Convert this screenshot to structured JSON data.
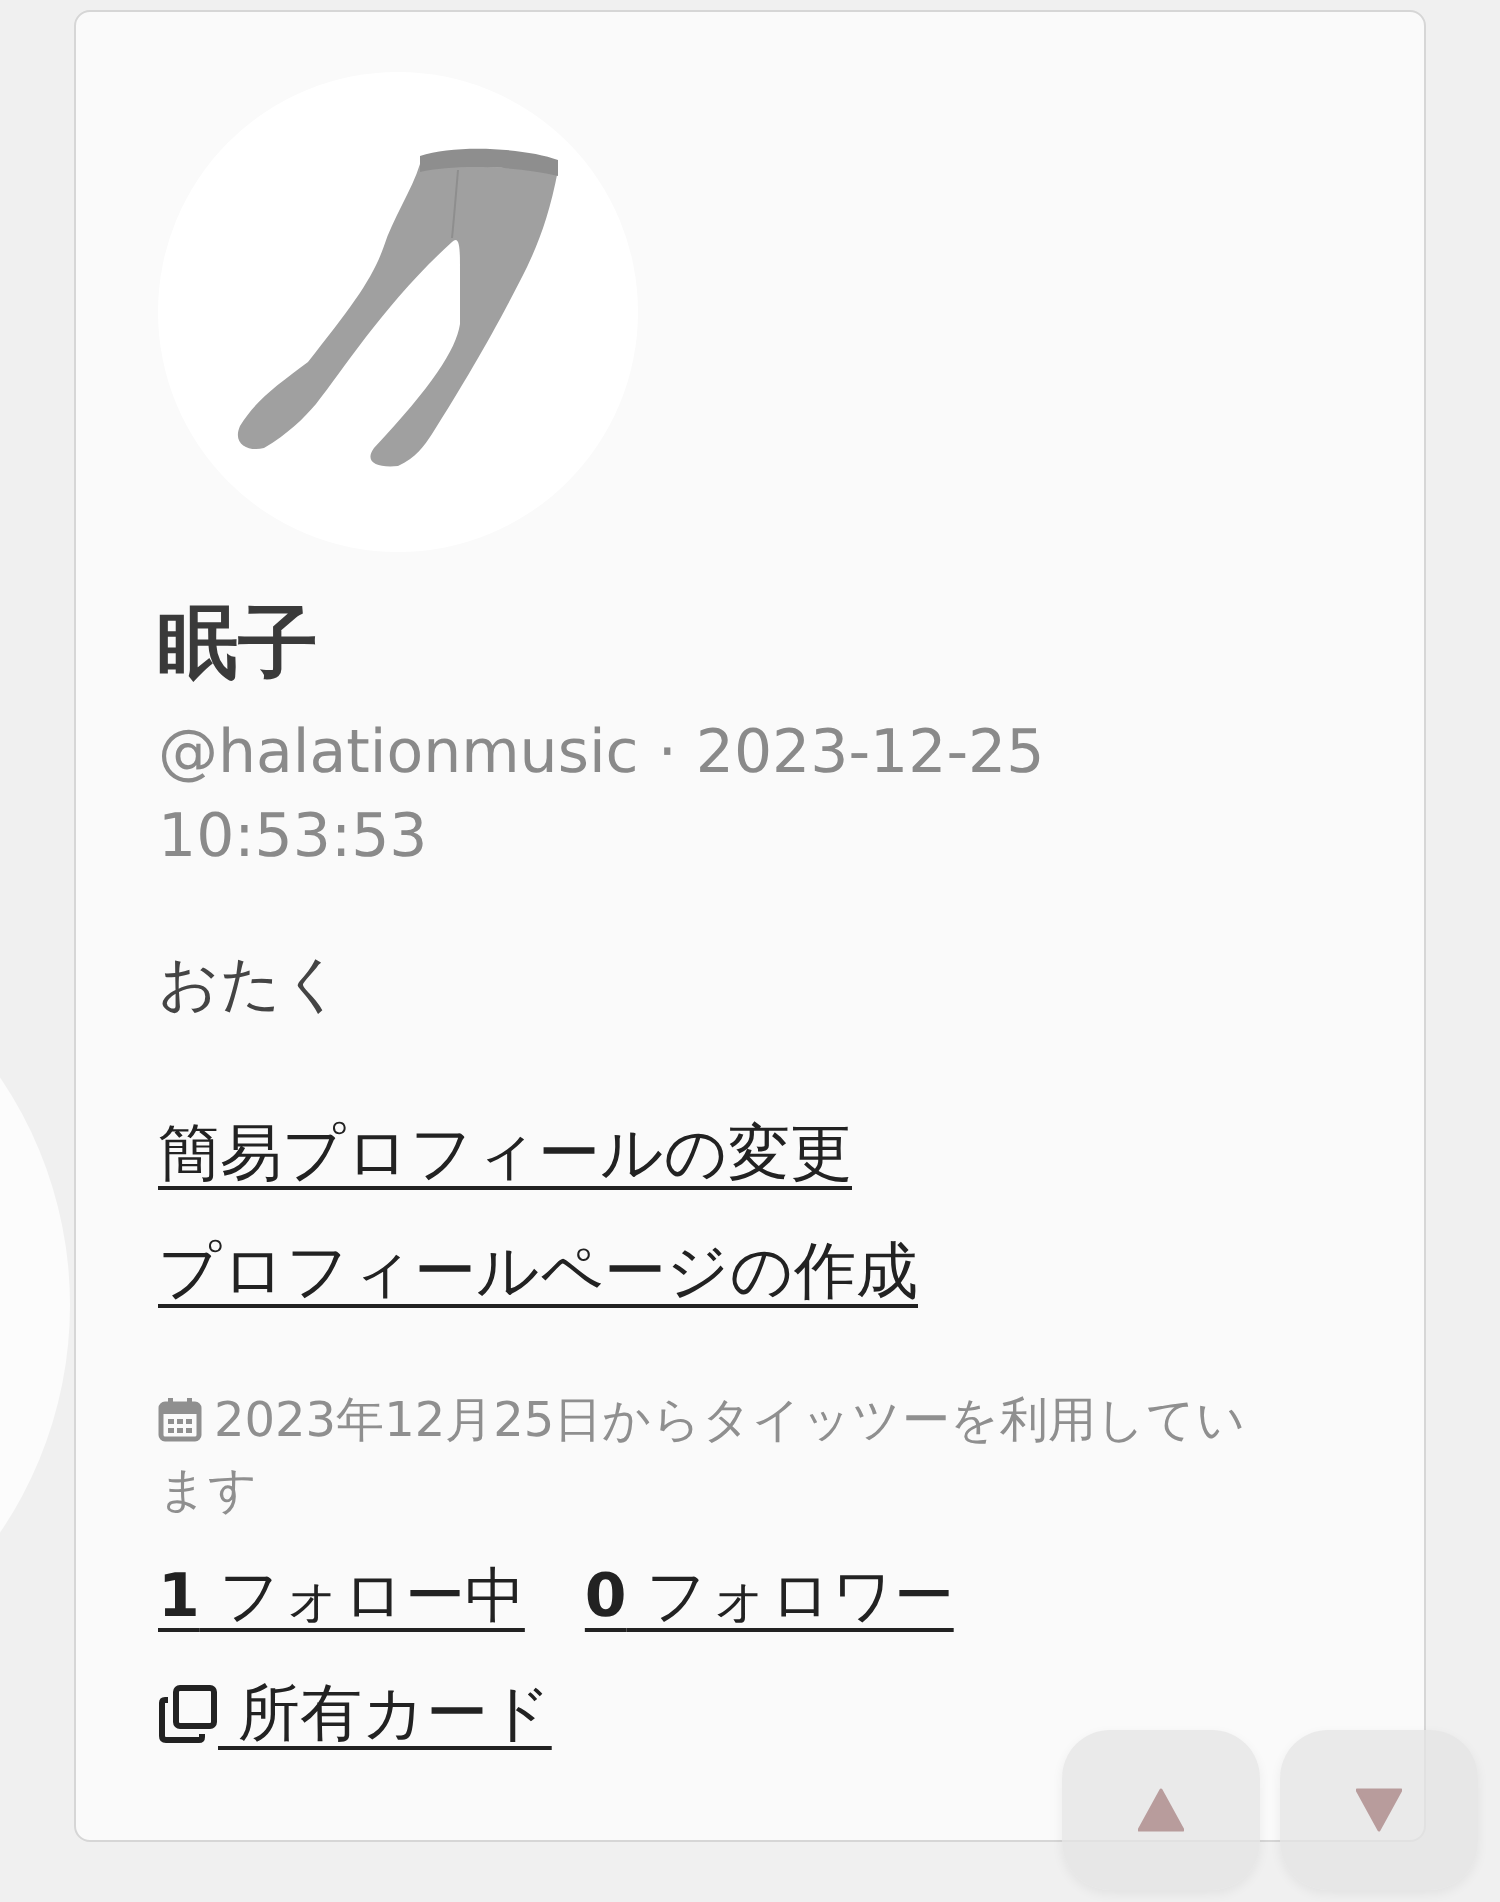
{
  "profile": {
    "name": "眠子",
    "meta": "@halationmusic · 2023-12-25 10:53:53",
    "bio": "おたく"
  },
  "links": [
    "簡易プロフィールの変更",
    "プロフィールページの作成"
  ],
  "member_since": "2023年12月25日からタイッツーを利用しています",
  "stats": [
    {
      "text": "**1** フォロー中"
    },
    {
      "text": "**0** フォロワー"
    }
  ],
  "cards_link": "所有カード",
  "scroll_buttons": [
    {
      "kind": "up"
    },
    {
      "kind": "down"
    }
  ]
}
